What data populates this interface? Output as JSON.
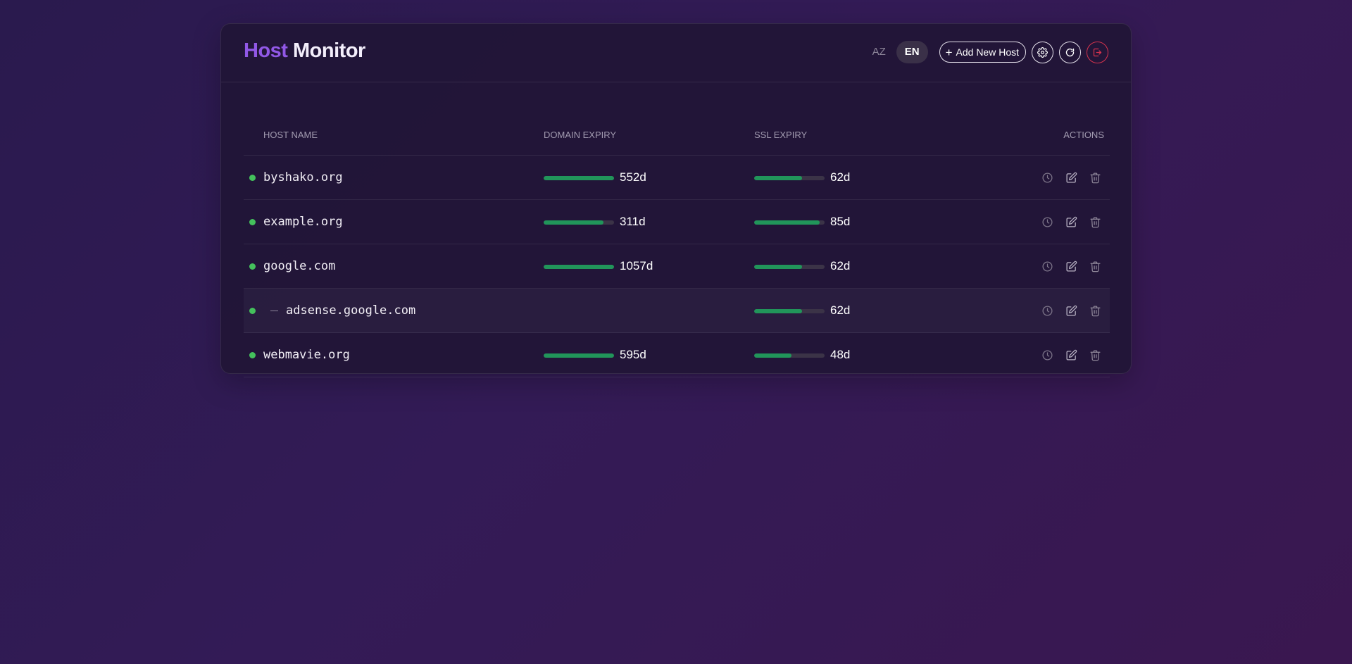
{
  "header": {
    "title_accent": "Host",
    "title_main": "Monitor",
    "lang_az": "AZ",
    "lang_en": "EN",
    "add_button_label": "Add New Host",
    "icons": [
      "plus-icon",
      "gear-icon",
      "refresh-icon",
      "logout-icon"
    ]
  },
  "colors": {
    "accent": "#9158e6",
    "status_ok": "#44c15c",
    "bar_fill": "#21955a",
    "logout": "#d6334e"
  },
  "table": {
    "columns": {
      "host": "HOST NAME",
      "domain": "DOMAIN EXPIRY",
      "ssl": "SSL EXPIRY",
      "actions": "ACTIONS"
    },
    "rows": [
      {
        "host": "byshako.org",
        "is_child": false,
        "domain_days": "552d",
        "domain_fill": 1.0,
        "ssl_days": "62d",
        "ssl_fill": 0.68
      },
      {
        "host": "example.org",
        "is_child": false,
        "domain_days": "311d",
        "domain_fill": 0.85,
        "ssl_days": "85d",
        "ssl_fill": 0.93
      },
      {
        "host": "google.com",
        "is_child": false,
        "domain_days": "1057d",
        "domain_fill": 1.0,
        "ssl_days": "62d",
        "ssl_fill": 0.68
      },
      {
        "host": "adsense.google.com",
        "is_child": true,
        "domain_days": "",
        "domain_fill": null,
        "ssl_days": "62d",
        "ssl_fill": 0.68
      },
      {
        "host": "webmavie.org",
        "is_child": false,
        "domain_days": "595d",
        "domain_fill": 1.0,
        "ssl_days": "48d",
        "ssl_fill": 0.53
      }
    ],
    "row_action_icons": [
      "history-icon",
      "edit-icon",
      "trash-icon"
    ]
  }
}
